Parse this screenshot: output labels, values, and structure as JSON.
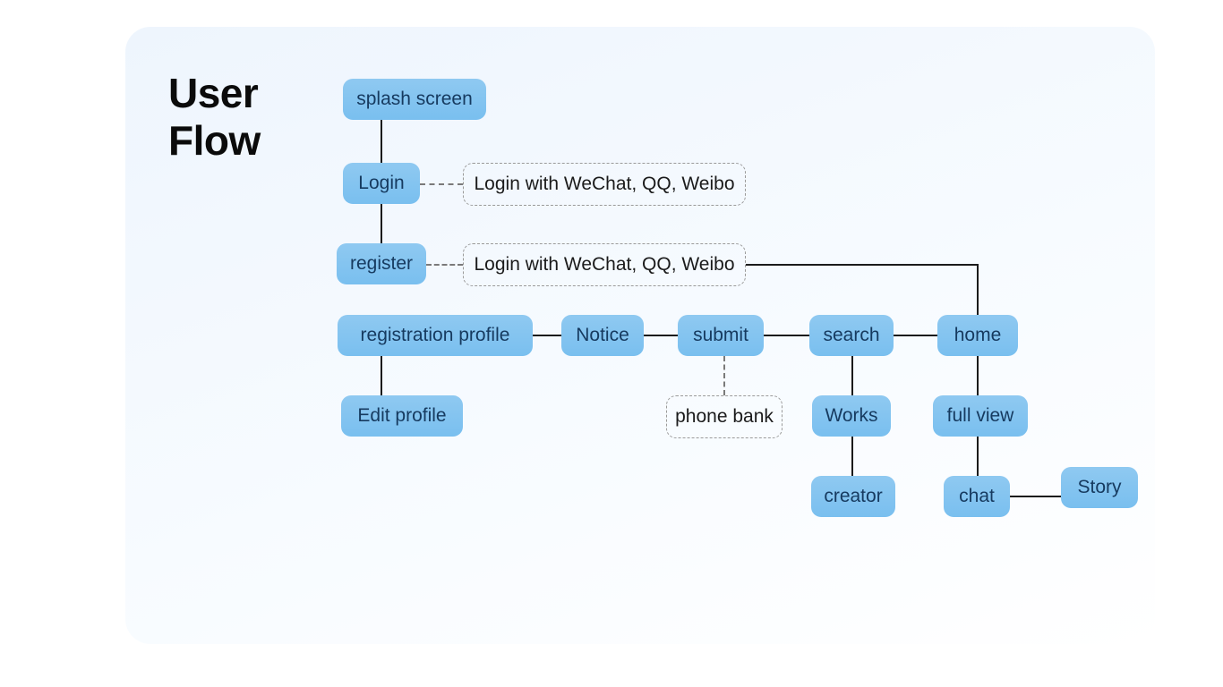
{
  "title_line1": "User",
  "title_line2": "Flow",
  "nodes": {
    "splash": "splash screen",
    "login": "Login",
    "register": "register",
    "reg_profile": "registration profile",
    "notice": "Notice",
    "submit": "submit",
    "search": "search",
    "home": "home",
    "edit_profile": "Edit profile",
    "works": "Works",
    "full_view": "full view",
    "creator": "creator",
    "chat": "chat",
    "story": "Story"
  },
  "annotations": {
    "login_anno": "Login with WeChat, QQ, Weibo",
    "register_anno": "Login with WeChat, QQ, Weibo",
    "phone_bank": "phone bank"
  }
}
